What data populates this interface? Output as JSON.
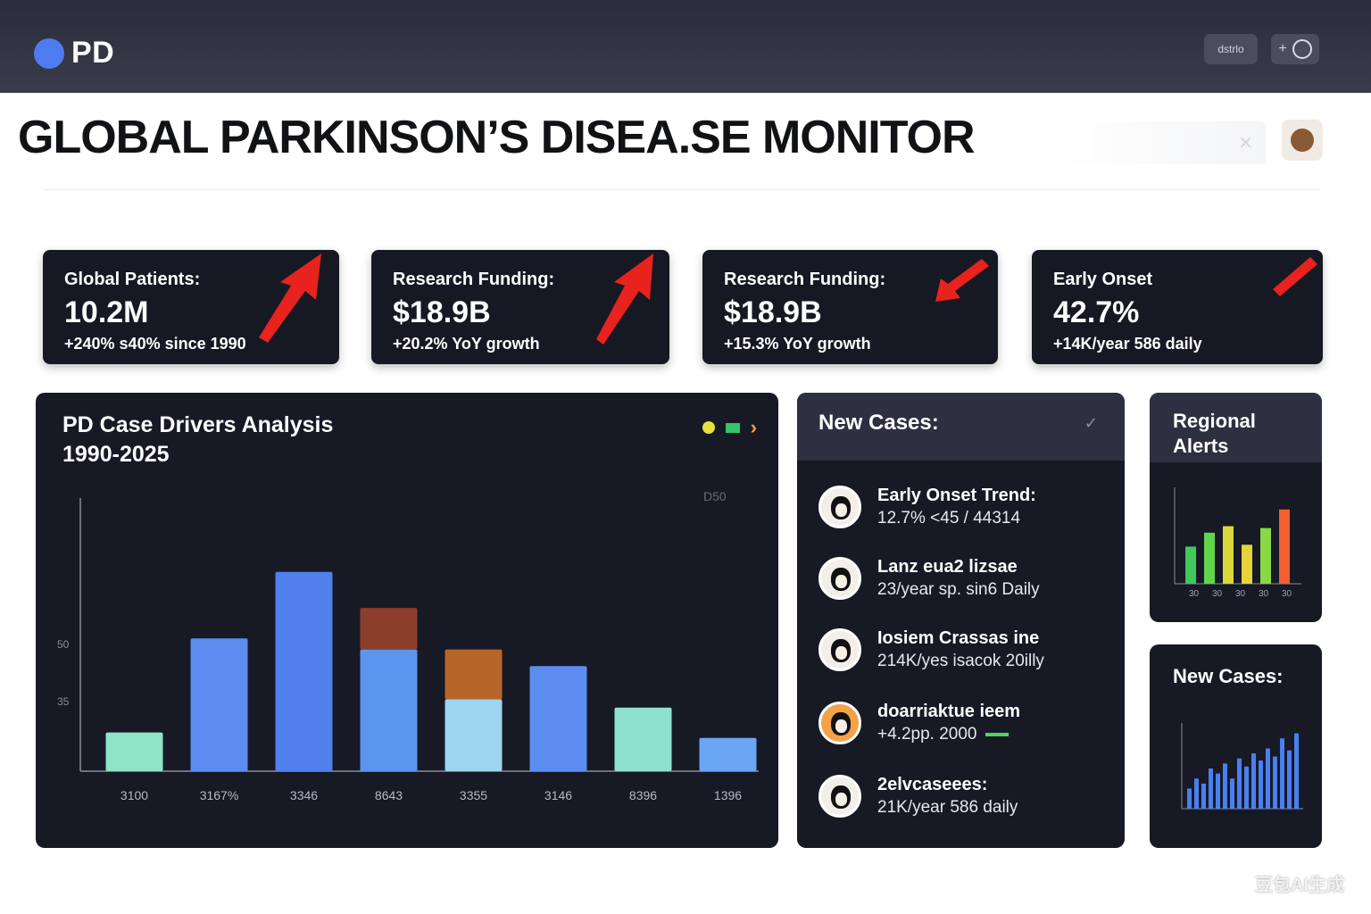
{
  "brand": {
    "name": "PD"
  },
  "topbar": {
    "pill1": "dstrlo",
    "pill2_glyph": "+"
  },
  "title": "GLOBAL PARKINSON’S DISEA.SE MONITOR",
  "search": {
    "close_glyph": "✕"
  },
  "kpis": [
    {
      "label": "Global Patients:",
      "value": "10.2M",
      "sub": "+240% s40% since 1990",
      "arrow": "up"
    },
    {
      "label": "Research Funding:",
      "value": "$18.9B",
      "sub": "+20.2% YoY growth",
      "arrow": "up"
    },
    {
      "label": "Research Funding:",
      "value": "$18.9B",
      "sub": "+15.3% YoY growth",
      "arrow": "down"
    },
    {
      "label": "Early Onset",
      "value": "42.7%",
      "sub": "+14K/year 586 daily",
      "arrow": "down"
    }
  ],
  "colors": {
    "accent_blue": "#4f7bf0",
    "arrow_red": "#e8221c",
    "panel_bg": "#171925",
    "panel_head": "#2d3040"
  },
  "drivers_chart": {
    "title_line1": "PD Case Drivers Analysis",
    "title_line2": "1990-2025",
    "corner_label": "D50"
  },
  "chart_data": [
    {
      "type": "bar",
      "title": "PD Case Drivers Analysis 1990-2025",
      "categories": [
        "3100",
        "3167%",
        "3346",
        "8643",
        "3355",
        "3146",
        "8396",
        "1396"
      ],
      "series": [
        {
          "values": [
            14,
            48,
            72,
            44,
            26,
            38,
            23,
            12
          ]
        },
        {
          "values": [
            0,
            0,
            0,
            15,
            18,
            0,
            0,
            0
          ]
        }
      ],
      "y_ticks": [
        "50",
        "35"
      ],
      "ylim": [
        0,
        100
      ],
      "bar_colors": [
        "#8fe3c6",
        "#5b8ef0",
        "#4f80ec",
        "#5b95f0",
        "#9ed4f0",
        "#5b8ef0",
        "#8ee0d0",
        "#6aa6f4"
      ],
      "stack_colors": [
        "",
        "",
        "",
        "#8c3e2a",
        "#b8652a",
        "",
        "",
        ""
      ]
    },
    {
      "type": "bar",
      "title": "Regional Alerts",
      "categories": [
        "30",
        "30",
        "30",
        "30",
        "30"
      ],
      "values": [
        40,
        55,
        62,
        42,
        60,
        80
      ],
      "bar_colors": [
        "#3ec95a",
        "#5fd54a",
        "#d9d83a",
        "#e4d43a",
        "#8bd845",
        "#f06030"
      ]
    },
    {
      "type": "bar",
      "title": "New Cases:",
      "values": [
        20,
        30,
        25,
        40,
        35,
        45,
        30,
        50,
        42,
        55,
        48,
        60,
        52,
        70,
        58,
        75
      ],
      "bar_colors": [
        "#4a7ff0"
      ]
    }
  ],
  "new_cases": {
    "title": "New Cases:",
    "icon": "check-icon",
    "items": [
      {
        "line1": "Early Onset Trend:",
        "line2": "12.7% <45 / 44314"
      },
      {
        "line1": "Lanz eua2 lizsae",
        "line2": "23/year sp. sin6 Daily"
      },
      {
        "line1": "Iosiem Crassas ine",
        "line2": "214K/yes isacok 20illy"
      },
      {
        "line1": "doarriaktue ieem",
        "line2": "+4.2pp. 2000"
      },
      {
        "line1": "2elvcaseees:",
        "line2": "21K/year 586 daily"
      }
    ]
  },
  "regional": {
    "title_line1": "Regional",
    "title_line2": "Alerts"
  },
  "new_cases_small": {
    "title": "New Cases:"
  },
  "watermark": "豆包AI生成"
}
